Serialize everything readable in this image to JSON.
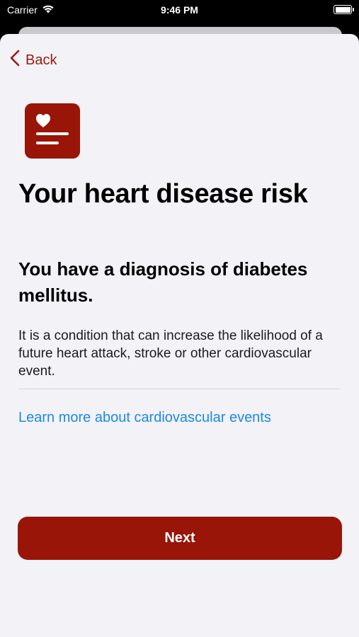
{
  "status_bar": {
    "carrier": "Carrier",
    "time": "9:46 PM",
    "battery_level": 1.0
  },
  "nav": {
    "back_label": "Back"
  },
  "icon": {
    "name": "heart-document-icon",
    "color": "#981508"
  },
  "content": {
    "title": "Your heart disease risk",
    "subtitle": "You have a diagnosis of diabetes mellitus.",
    "body": "It is a condition that can increase the likelihood of a future heart attack, stroke or other cardiovascular event.",
    "link": "Learn more about cardiovascular events"
  },
  "actions": {
    "next_label": "Next"
  },
  "colors": {
    "accent": "#981508",
    "link": "#1e88e5",
    "background": "#f2f2f7"
  }
}
